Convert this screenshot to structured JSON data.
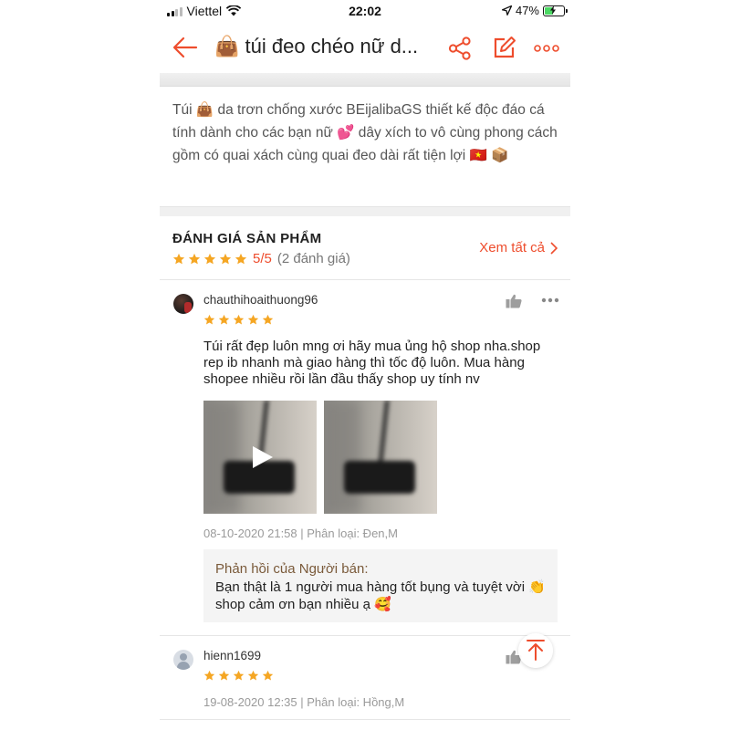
{
  "status_bar": {
    "carrier": "Viettel",
    "time": "22:02",
    "battery_percent": "47%",
    "battery_level": 0.47
  },
  "header": {
    "title": "👜 túi đeo chéo nữ d...",
    "icons": [
      "back-arrow-icon",
      "share-icon",
      "edit-icon",
      "more-icon"
    ]
  },
  "description": {
    "text": "Túi 👜 da trơn chống xước BEijalibaGS thiết kế độc đáo cá tính dành cho các bạn nữ 💕 dây xích to vô cùng phong cách gồm có quai xách cùng quai đeo dài rất tiện lợi 🇻🇳 📦"
  },
  "ratings": {
    "title": "ĐÁNH GIÁ SẢN PHẨM",
    "score": "5/5",
    "count": "(2 đánh giá)",
    "stars": 5,
    "see_all": "Xem tất cả",
    "reviews": [
      {
        "username": "chauthihoaithuong96",
        "stars": 5,
        "text": "Túi rất đẹp luôn mng ơi hãy mua ủng hộ shop nha.shop rep ib nhanh mà giao hàng thì tốc độ luôn. Mua hàng shopee nhiều rồi lần đầu thấy shop uy tính nv",
        "meta": "08-10-2020 21:58 | Phân loại: Đen,M",
        "seller_reply_title": "Phản hồi của Người bán:",
        "seller_reply_text": "Bạn thật là 1 người mua hàng tốt bụng và tuyệt vời 👏 shop cảm ơn bạn nhiều ạ 🥰"
      },
      {
        "username": "hienn1699",
        "stars": 5,
        "meta": "19-08-2020 12:35 | Phân loại: Hồng,M"
      }
    ]
  },
  "colors": {
    "accent": "#ee4d2d",
    "star": "#f5a623",
    "divider": "#e6e6e6"
  }
}
